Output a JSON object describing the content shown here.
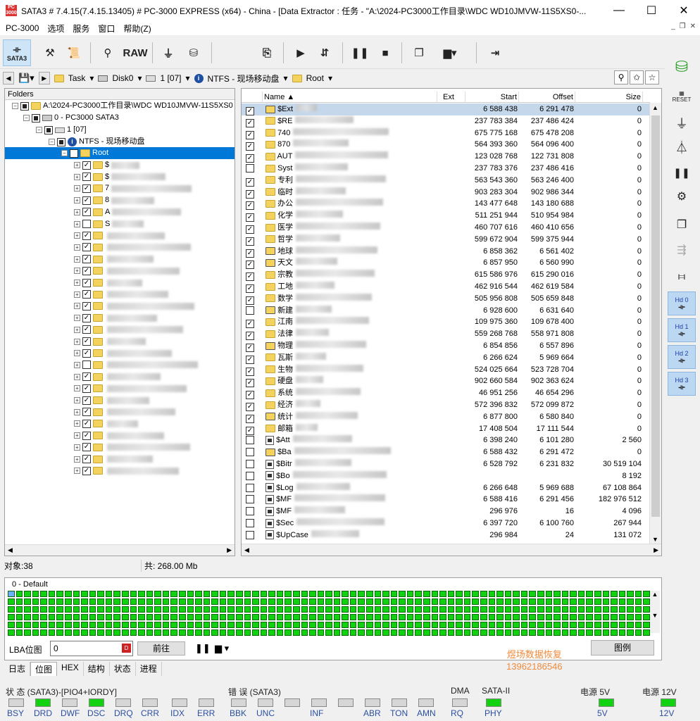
{
  "window": {
    "title": "SATA3 # 7.4.15(7.4.15.13405) # PC-3000 EXPRESS (x64) - China - [Data Extractor : 任务 - \"A:\\2024-PC3000工作目录\\WDC WD10JMVW-11S5XS0-...",
    "minimize": "—",
    "maximize": "☐",
    "close": "✕"
  },
  "menu": [
    "PC-3000",
    "选项",
    "服务",
    "窗口",
    "帮助(Z)"
  ],
  "toolbar": {
    "sata3": "SATA3",
    "raw": "RAW"
  },
  "nav": {
    "task": "Task",
    "disk": "Disk0",
    "partition": "1 [07]",
    "fs": "NTFS - 现场移动盘",
    "root": "Root"
  },
  "folders": {
    "header": "Folders",
    "path": "A:\\2024-PC3000工作目录\\WDC WD10JMVW-11S5XS0",
    "device": "0 - PC3000 SATA3",
    "partition": "1 [07]",
    "fs": "NTFS - 现场移动盘",
    "root": "Root",
    "children": [
      {
        "prefix": "$",
        "checked": true,
        "special": false
      },
      {
        "prefix": "$",
        "checked": true,
        "special": false
      },
      {
        "prefix": "7",
        "checked": true,
        "special": false
      },
      {
        "prefix": "8",
        "checked": true,
        "special": false
      },
      {
        "prefix": "A",
        "checked": true,
        "special": false
      },
      {
        "prefix": "S",
        "checked": false,
        "special": false
      },
      {
        "prefix": "",
        "checked": true,
        "special": false
      },
      {
        "prefix": "",
        "checked": true,
        "special": false
      },
      {
        "prefix": "",
        "checked": true,
        "special": false
      },
      {
        "prefix": "",
        "checked": true,
        "special": false
      },
      {
        "prefix": "",
        "checked": true,
        "special": false
      },
      {
        "prefix": "",
        "checked": true,
        "special": false
      },
      {
        "prefix": "",
        "checked": true,
        "special": true
      },
      {
        "prefix": "",
        "checked": true,
        "special": true
      },
      {
        "prefix": "",
        "checked": true,
        "special": false
      },
      {
        "prefix": "",
        "checked": true,
        "special": false
      },
      {
        "prefix": "",
        "checked": true,
        "special": false
      },
      {
        "prefix": "",
        "checked": false,
        "special": true
      },
      {
        "prefix": "",
        "checked": true,
        "special": false
      },
      {
        "prefix": "",
        "checked": true,
        "special": false
      },
      {
        "prefix": "",
        "checked": true,
        "special": true
      },
      {
        "prefix": "",
        "checked": true,
        "special": false
      },
      {
        "prefix": "",
        "checked": true,
        "special": false
      },
      {
        "prefix": "",
        "checked": true,
        "special": false
      },
      {
        "prefix": "",
        "checked": true,
        "special": false
      },
      {
        "prefix": "",
        "checked": true,
        "special": true
      },
      {
        "prefix": "",
        "checked": true,
        "special": false
      }
    ]
  },
  "files": {
    "columns": {
      "name": "Name",
      "ext": "Ext",
      "start": "Start",
      "offset": "Offset",
      "size": "Size"
    },
    "rows": [
      {
        "name": "$Ext",
        "start": "6 588 438",
        "offset": "6 291 478",
        "size": "0",
        "checked": true,
        "type": "special"
      },
      {
        "name": "$RE",
        "start": "237 783 384",
        "offset": "237 486 424",
        "size": "0",
        "checked": true,
        "type": "folder"
      },
      {
        "name": "740",
        "start": "675 775 168",
        "offset": "675 478 208",
        "size": "0",
        "checked": true,
        "type": "folder"
      },
      {
        "name": "870",
        "start": "564 393 360",
        "offset": "564 096 400",
        "size": "0",
        "checked": true,
        "type": "folder"
      },
      {
        "name": "AUT",
        "start": "123 028 768",
        "offset": "122 731 808",
        "size": "0",
        "checked": true,
        "type": "folder"
      },
      {
        "name": "Syst",
        "start": "237 783 376",
        "offset": "237 486 416",
        "size": "0",
        "checked": false,
        "type": "folder"
      },
      {
        "name": "专利",
        "start": "563 543 360",
        "offset": "563 246 400",
        "size": "0",
        "checked": true,
        "type": "folder"
      },
      {
        "name": "临时",
        "start": "903 283 304",
        "offset": "902 986 344",
        "size": "0",
        "checked": true,
        "type": "folder"
      },
      {
        "name": "办公",
        "start": "143 477 648",
        "offset": "143 180 688",
        "size": "0",
        "checked": true,
        "type": "folder"
      },
      {
        "name": "化学",
        "start": "511 251 944",
        "offset": "510 954 984",
        "size": "0",
        "checked": true,
        "type": "folder"
      },
      {
        "name": "医学",
        "start": "460 707 616",
        "offset": "460 410 656",
        "size": "0",
        "checked": true,
        "type": "folder"
      },
      {
        "name": "哲学",
        "start": "599 672 904",
        "offset": "599 375 944",
        "size": "0",
        "checked": true,
        "type": "folder"
      },
      {
        "name": "地球",
        "start": "6 858 362",
        "offset": "6 561 402",
        "size": "0",
        "checked": true,
        "type": "special"
      },
      {
        "name": "天文",
        "start": "6 857 950",
        "offset": "6 560 990",
        "size": "0",
        "checked": true,
        "type": "special"
      },
      {
        "name": "宗教",
        "start": "615 586 976",
        "offset": "615 290 016",
        "size": "0",
        "checked": true,
        "type": "folder"
      },
      {
        "name": "工地",
        "start": "462 916 544",
        "offset": "462 619 584",
        "size": "0",
        "checked": true,
        "type": "folder"
      },
      {
        "name": "数学",
        "start": "505 956 808",
        "offset": "505 659 848",
        "size": "0",
        "checked": true,
        "type": "folder"
      },
      {
        "name": "新建",
        "start": "6 928 600",
        "offset": "6 631 640",
        "size": "0",
        "checked": false,
        "type": "special"
      },
      {
        "name": "江南",
        "start": "109 975 360",
        "offset": "109 678 400",
        "size": "0",
        "checked": true,
        "type": "folder"
      },
      {
        "name": "法律",
        "start": "559 268 768",
        "offset": "558 971 808",
        "size": "0",
        "checked": true,
        "type": "folder"
      },
      {
        "name": "物理",
        "start": "6 854 856",
        "offset": "6 557 896",
        "size": "0",
        "checked": true,
        "type": "special"
      },
      {
        "name": "瓦斯",
        "start": "6 266 624",
        "offset": "5 969 664",
        "size": "0",
        "checked": true,
        "type": "folder"
      },
      {
        "name": "生物",
        "start": "524 025 664",
        "offset": "523 728 704",
        "size": "0",
        "checked": true,
        "type": "folder"
      },
      {
        "name": "硬盘",
        "start": "902 660 584",
        "offset": "902 363 624",
        "size": "0",
        "checked": true,
        "type": "folder"
      },
      {
        "name": "系统",
        "start": "46 951 256",
        "offset": "46 654 296",
        "size": "0",
        "checked": true,
        "type": "folder"
      },
      {
        "name": "经济",
        "start": "572 396 832",
        "offset": "572 099 872",
        "size": "0",
        "checked": true,
        "type": "folder"
      },
      {
        "name": "统计",
        "start": "6 877 800",
        "offset": "6 580 840",
        "size": "0",
        "checked": true,
        "type": "special"
      },
      {
        "name": "邮箱",
        "start": "17 408 504",
        "offset": "17 111 544",
        "size": "0",
        "checked": true,
        "type": "folder"
      },
      {
        "name": "$Att",
        "start": "6 398 240",
        "offset": "6 101 280",
        "size": "2 560",
        "checked": false,
        "type": "file"
      },
      {
        "name": "$Ba",
        "start": "6 588 432",
        "offset": "6 291 472",
        "size": "0",
        "checked": false,
        "type": "special"
      },
      {
        "name": "$Bitr",
        "start": "6 528 792",
        "offset": "6 231 832",
        "size": "30 519 104",
        "checked": false,
        "type": "file"
      },
      {
        "name": "$Bo",
        "start": "",
        "offset": "",
        "size": "8 192",
        "checked": false,
        "type": "file"
      },
      {
        "name": "$Log",
        "start": "6 266 648",
        "offset": "5 969 688",
        "size": "67 108 864",
        "checked": false,
        "type": "file"
      },
      {
        "name": "$MF",
        "start": "6 588 416",
        "offset": "6 291 456",
        "size": "182 976 512",
        "checked": false,
        "type": "file"
      },
      {
        "name": "$MF",
        "start": "296 976",
        "offset": "16",
        "size": "4 096",
        "checked": false,
        "type": "file"
      },
      {
        "name": "$Sec",
        "start": "6 397 720",
        "offset": "6 100 760",
        "size": "267 944",
        "checked": false,
        "type": "file"
      },
      {
        "name": "$UpCase",
        "start": "296 984",
        "offset": "24",
        "size": "131 072",
        "checked": false,
        "type": "file"
      }
    ]
  },
  "status": {
    "objects": "对象:38",
    "total": "共: 268.00 Mb"
  },
  "bitmap": {
    "title": "0 - Default",
    "lba_label": "LBA位图",
    "lba_value": "0",
    "goto": "前往",
    "legend": "图例",
    "watermark_line1": "煜场数据恢复",
    "watermark_line2": "13962186546"
  },
  "bottom_tabs": [
    "日志",
    "位图",
    "HEX",
    "结构",
    "状态",
    "进程"
  ],
  "indicators": {
    "status_group": "状 态 (SATA3)-[PIO4+IORDY]",
    "error_group": "错 误 (SATA3)",
    "dma_group": "DMA",
    "sata_group": "SATA-II",
    "power5": "电源 5V",
    "power12": "电源 12V",
    "status_leds": [
      {
        "label": "BSY",
        "on": false
      },
      {
        "label": "DRD",
        "on": true
      },
      {
        "label": "DWF",
        "on": false
      },
      {
        "label": "DSC",
        "on": true
      },
      {
        "label": "DRQ",
        "on": false
      },
      {
        "label": "CRR",
        "on": false
      },
      {
        "label": "IDX",
        "on": false
      },
      {
        "label": "ERR",
        "on": false
      }
    ],
    "error_leds": [
      {
        "label": "BBK",
        "on": false
      },
      {
        "label": "UNC",
        "on": false
      },
      {
        "label": "",
        "on": false
      },
      {
        "label": "INF",
        "on": false
      },
      {
        "label": "",
        "on": false
      },
      {
        "label": "ABR",
        "on": false
      },
      {
        "label": "TON",
        "on": false
      },
      {
        "label": "AMN",
        "on": false
      }
    ],
    "dma_led": {
      "label": "RQ",
      "on": false
    },
    "sata_led": {
      "label": "PHY",
      "on": true
    },
    "p5_led": {
      "label": "5V",
      "on": true
    },
    "p12_led": {
      "label": "12V",
      "on": true
    }
  },
  "rightbar": {
    "reset": "RESET",
    "hd": [
      "Hd 0",
      "Hd 1",
      "Hd 2",
      "Hd 3"
    ]
  },
  "colors": {
    "led_on": "#11d111",
    "selection": "#0078d7",
    "watermark": "#f08a3c"
  }
}
